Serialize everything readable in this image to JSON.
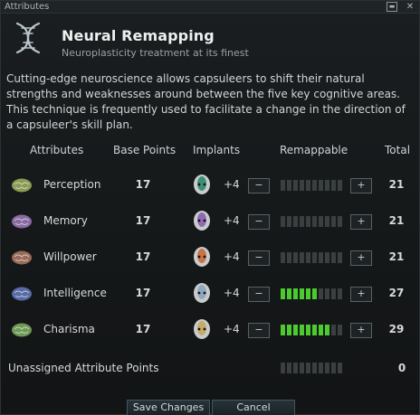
{
  "window": {
    "title": "Attributes"
  },
  "header": {
    "title": "Neural Remapping",
    "subtitle": "Neuroplasticity treatment at its finest"
  },
  "description": "Cutting-edge neuroscience allows capsuleers to shift their natural strengths and weaknesses around between the five key cognitive areas. This technique is frequently used to facilitate a change in the direction of a capsuleer's skill plan.",
  "columns": {
    "attributes": "Attributes",
    "base_points": "Base Points",
    "implants": "Implants",
    "remappable": "Remappable",
    "total": "Total"
  },
  "attributes": [
    {
      "name": "Perception",
      "base": "17",
      "implant": "+4",
      "total": "21",
      "remap_filled": 0,
      "remap_max": 10,
      "brain_color": "#8c9a55",
      "implant_color": "#2f8a6a",
      "minus": "−",
      "plus": "+"
    },
    {
      "name": "Memory",
      "base": "17",
      "implant": "+4",
      "total": "21",
      "remap_filled": 0,
      "remap_max": 10,
      "brain_color": "#8a6aa3",
      "implant_color": "#8a5fb0",
      "minus": "−",
      "plus": "+"
    },
    {
      "name": "Willpower",
      "base": "17",
      "implant": "+4",
      "total": "21",
      "remap_filled": 0,
      "remap_max": 10,
      "brain_color": "#9a6a5a",
      "implant_color": "#c56a3a",
      "minus": "−",
      "plus": "+"
    },
    {
      "name": "Intelligence",
      "base": "17",
      "implant": "+4",
      "total": "27",
      "remap_filled": 6,
      "remap_max": 10,
      "brain_color": "#5a6aa8",
      "implant_color": "#8aa4bd",
      "minus": "−",
      "plus": "+"
    },
    {
      "name": "Charisma",
      "base": "17",
      "implant": "+4",
      "total": "29",
      "remap_filled": 8,
      "remap_max": 10,
      "brain_color": "#6f9a56",
      "implant_color": "#c4a85a",
      "minus": "−",
      "plus": "+"
    }
  ],
  "unassigned": {
    "label": "Unassigned Attribute Points",
    "value": "0",
    "max": 10
  },
  "buttons": {
    "save": "Save Changes",
    "cancel": "Cancel"
  },
  "titlebar_buttons": {
    "minimize": "▬",
    "close": "✕"
  },
  "colors": {
    "accent_green": "#4ccb2e",
    "segment_off": "#3a3f41"
  }
}
